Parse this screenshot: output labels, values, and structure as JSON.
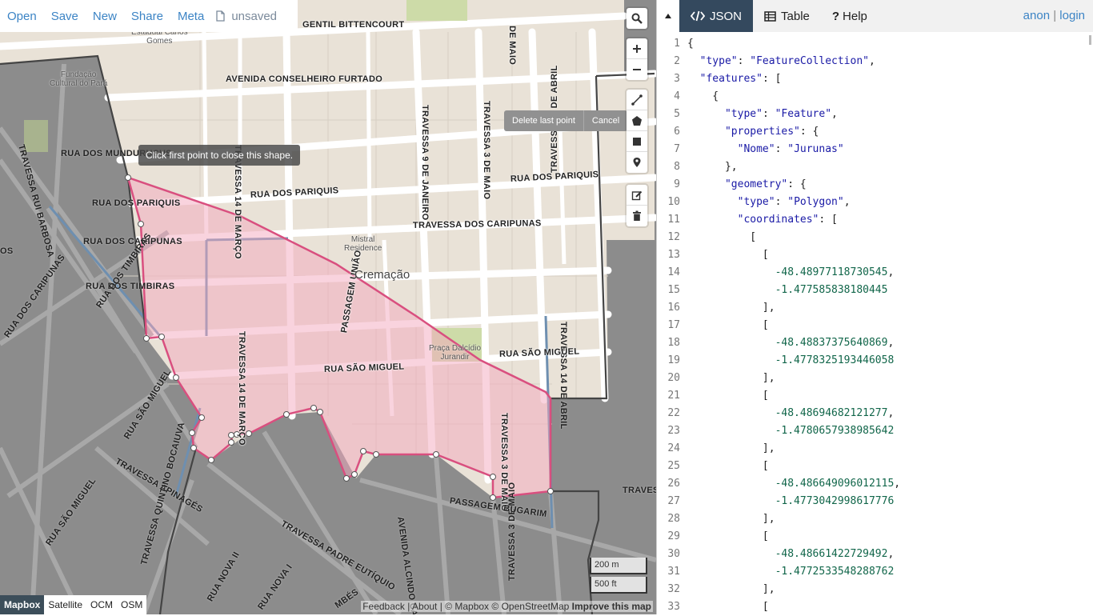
{
  "menu": {
    "items": [
      "Open",
      "Save",
      "New",
      "Share",
      "Meta"
    ],
    "file_status": "unsaved"
  },
  "map": {
    "draw_tooltip": "Click first point to close this shape.",
    "draw_actions": [
      "Delete last point",
      "Cancel"
    ],
    "scale_metric": "200 m",
    "scale_imperial": "500 ft",
    "attribution": {
      "feedback": "Feedback",
      "about": "About",
      "mapbox": "© Mapbox",
      "osm": "© OpenStreetMap",
      "improve": "Improve this map"
    },
    "layers": [
      "Mapbox",
      "Satellite",
      "OCM",
      "OSM"
    ],
    "active_layer": "Mapbox",
    "labels": {
      "gentil": "GENTIL BITTENCOURT",
      "conselheiro": "AVENIDA CONSELHEIRO FURTADO",
      "mundurucus": "RUA DOS MUNDURUCUS",
      "pariquis_left": "RUA DOS PARIQUIS",
      "pariquis_mid": "RUA DOS PARIQUIS",
      "pariquis_right": "RUA DOS PARIQUIS",
      "caripunas_left": "RUA DOS CARIPUNAS",
      "caripunas_mid": "TRAVESSA DOS CARIPUNAS",
      "caripunas_diag": "RUA DOS CARIPUNAS",
      "timbiras_left": "RUA DOS TIMBIRAS",
      "timbiras_diag": "RUA DOS TIMBIRAS",
      "rui_barbosa": "TRAVESSA RUI BARBOSA",
      "catorze_marco_top": "TRAVESSA 14 DE MARÇO",
      "catorze_marco": "TRAVESSA 14 DE MARÇO",
      "nove_janeiro": "TRAVESSA 9 DE JANEIRO",
      "tres_maio_top": "TRAVESSA 3 DE MAIO",
      "tres_maio": "TRAVESSA 3 DE MAIO",
      "tres_maio_bottom": "TRAVESSA 3 DE MAIO",
      "maio_top": "DE MAIO",
      "catorze_abril_top": "TRAVESSA 14 DE ABRIL",
      "catorze_abril": "TRAVESSA 14 DE ABRIL",
      "uniao": "PASSAGEM UNIÃO",
      "sao_miguel": "RUA SÃO MIGUEL",
      "sao_miguel_right": "RUA SÃO MIGUEL",
      "sao_miguel_diag": "RUA SÃO MIGUEL",
      "sao_miguel_sw": "RUA SÃO MIGUEL",
      "apinages": "TRAVESSA APINAGÉS",
      "alcindo": "AVENIDA ALCINDO CACELA",
      "bugarim": "PASSAGEM BUGARIM",
      "eutiquio": "TRAVESSA PADRE EUTÍQUIO",
      "bocaiuva": "TRAVESSA QUINTINO BOCAIUVA",
      "nova2": "RUA NOVA II",
      "nova1": "RUA NOVA I",
      "os": "OS",
      "traves": "TRAVES",
      "mbes": "MBÉS"
    },
    "pois": {
      "estadual": "Estadual Carlos\nGomes",
      "fundacao": "Fundação\nCultural do Pará",
      "mistral": "Mistral\nResidence",
      "praca": "Praça Dalcídio\nJurandir"
    },
    "place": "Cremação"
  },
  "pane": {
    "tabs": [
      "JSON",
      "Table",
      "Help"
    ],
    "active_tab": "JSON",
    "user": {
      "anon": "anon",
      "sep": "|",
      "login": "login"
    }
  },
  "code_lines": [
    "{",
    "  \"type\": \"FeatureCollection\",",
    "  \"features\": [",
    "    {",
    "      \"type\": \"Feature\",",
    "      \"properties\": {",
    "        \"Nome\": \"Jurunas\"",
    "      },",
    "      \"geometry\": {",
    "        \"type\": \"Polygon\",",
    "        \"coordinates\": [",
    "          [",
    "            [",
    "              -48.48977118730545,",
    "              -1.477585838180445",
    "            ],",
    "            [",
    "              -48.48837375640869,",
    "              -1.4778325193446058",
    "            ],",
    "            [",
    "              -48.48694682121277,",
    "              -1.4780657938985642",
    "            ],",
    "            [",
    "              -48.486649096012115,",
    "              -1.4773042998617776",
    "            ],",
    "            [",
    "              -48.48661422729492,",
    "              -1.4772533548288762",
    "            ],",
    "            ["
  ]
}
